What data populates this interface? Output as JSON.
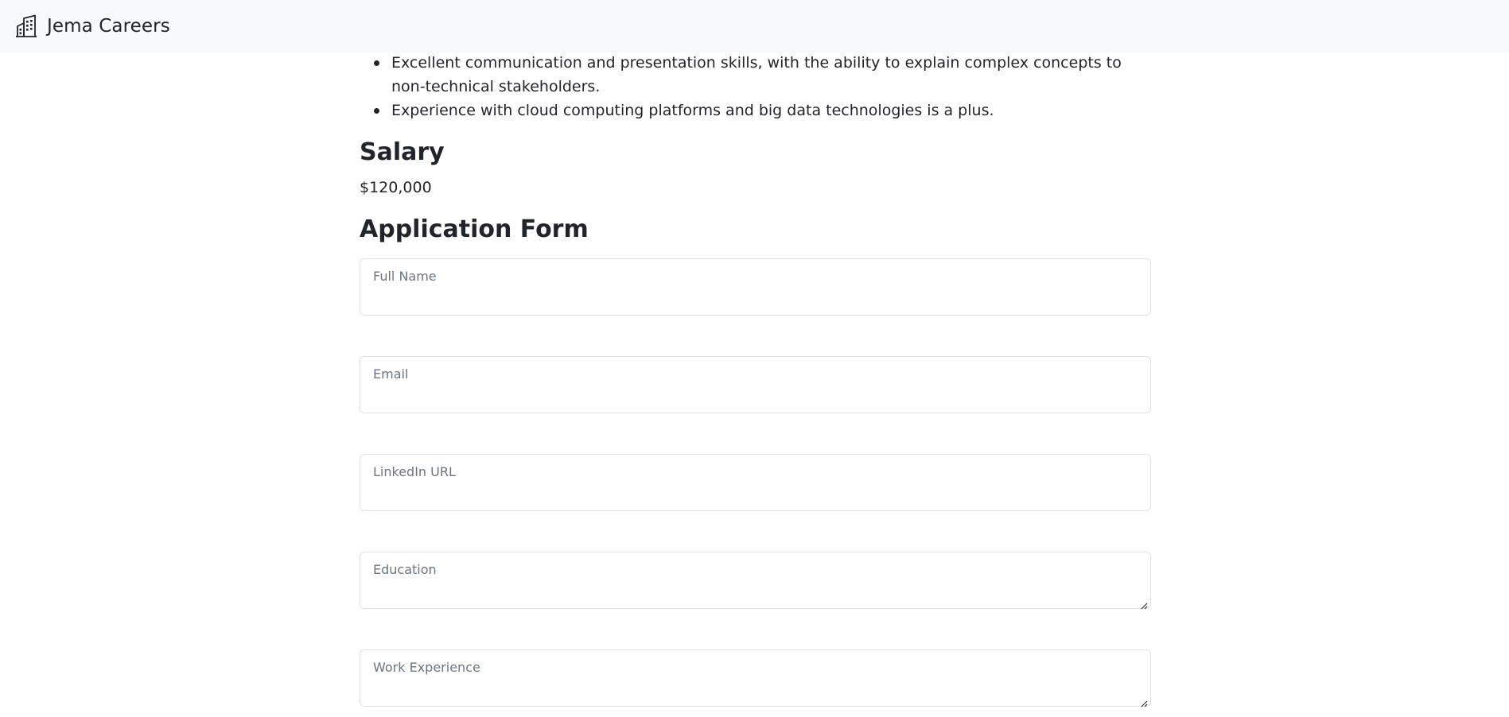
{
  "navbar": {
    "brand_name": "Jema Careers",
    "brand_icon": "building-icon"
  },
  "requirements": [
    "Excellent communication and presentation skills, with the ability to explain complex concepts to non-technical stakeholders.",
    "Experience with cloud computing platforms and big data technologies is a plus."
  ],
  "salary": {
    "heading": "Salary",
    "value": "$120,000"
  },
  "application_form": {
    "heading": "Application Form",
    "full_name": {
      "label": "Full Name",
      "value": ""
    },
    "email": {
      "label": "Email",
      "value": ""
    },
    "linkedin": {
      "label": "LinkedIn URL",
      "value": ""
    },
    "education": {
      "label": "Education",
      "value": ""
    },
    "work_experience": {
      "label": "Work Experience",
      "value": ""
    }
  }
}
